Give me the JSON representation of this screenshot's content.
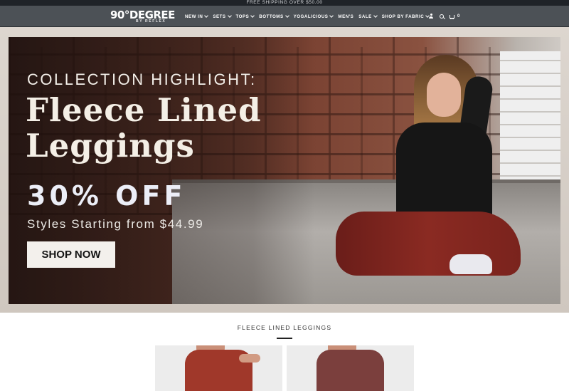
{
  "announcement": "FREE SHIPPING OVER $50.00",
  "logo": {
    "main": "90°DEGREE",
    "sub": "BY REFLEX"
  },
  "nav": {
    "items": [
      {
        "label": "NEW IN",
        "dropdown": true
      },
      {
        "label": "SETS",
        "dropdown": true
      },
      {
        "label": "TOPS",
        "dropdown": true
      },
      {
        "label": "BOTTOMS",
        "dropdown": true
      },
      {
        "label": "YOGALICIOUS",
        "dropdown": true
      },
      {
        "label": "MEN'S",
        "dropdown": false
      },
      {
        "label": "SALE",
        "dropdown": true
      },
      {
        "label": "SHOP BY FABRIC",
        "dropdown": true
      }
    ]
  },
  "utility": {
    "cart_count": "0",
    "icons": [
      "user-icon",
      "search-icon",
      "cart-icon"
    ]
  },
  "hero": {
    "eyebrow": "COLLECTION HIGHLIGHT:",
    "headline": "Fleece Lined Leggings",
    "discount": "30% OFF",
    "subline": "Styles Starting from $44.99",
    "cta": "SHOP NOW"
  },
  "products": {
    "section_title": "FLEECE LINED LEGGINGS",
    "cards": [
      {
        "color": "#a0382a"
      },
      {
        "color": "#7b3f3d"
      }
    ]
  },
  "colors": {
    "header_bg": "#4c5156",
    "announcement_bg": "#1f2328",
    "button_bg": "#f3f0ec"
  }
}
